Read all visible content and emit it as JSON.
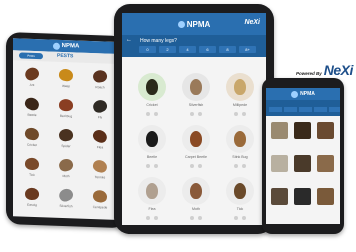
{
  "brand": {
    "app_name": "NPMA",
    "powered_by": "Powered By",
    "nexi": "NeXi"
  },
  "left_tablet": {
    "nav_button": "Pests",
    "section_title": "PESTS",
    "items": [
      {
        "label": "Ant",
        "color": "#6b3a1f"
      },
      {
        "label": "Wasp",
        "color": "#c98a1a"
      },
      {
        "label": "Roach",
        "color": "#5a3320"
      },
      {
        "label": "Beetle",
        "color": "#3a2618"
      },
      {
        "label": "Bed Bug",
        "color": "#8a3e22"
      },
      {
        "label": "Fly",
        "color": "#2f2a24"
      },
      {
        "label": "Cricket",
        "color": "#6f4a2a"
      },
      {
        "label": "Spider",
        "color": "#4a3220"
      },
      {
        "label": "Flea",
        "color": "#5a2e18"
      },
      {
        "label": "Tick",
        "color": "#7a4a2a"
      },
      {
        "label": "Moth",
        "color": "#8a6a4a"
      },
      {
        "label": "Termite",
        "color": "#b08050"
      },
      {
        "label": "Earwig",
        "color": "#6a3a20"
      },
      {
        "label": "Silverfish",
        "color": "#8c8c8c"
      },
      {
        "label": "Centipede",
        "color": "#9a6a3a"
      }
    ]
  },
  "center_tablet": {
    "question": "How many legs?",
    "back_icon": "arrow-left-icon",
    "chips": [
      "0",
      "2",
      "4",
      "6",
      "8",
      "8+"
    ],
    "items": [
      {
        "label": "Cricket",
        "bg": "#d8ead0",
        "bug": "#2a2a1a"
      },
      {
        "label": "Silverfish",
        "bg": "#e6e6e6",
        "bug": "#9a7a5a"
      },
      {
        "label": "Millipede",
        "bg": "#eadfcf",
        "bug": "#c9a76a"
      },
      {
        "label": "Beetle",
        "bg": "#ececec",
        "bug": "#1a1a1a"
      },
      {
        "label": "Carpet Beetle",
        "bg": "#ececec",
        "bug": "#8a4a24"
      },
      {
        "label": "Stink Bug",
        "bg": "#ececec",
        "bug": "#9a6a3a"
      },
      {
        "label": "Flea",
        "bg": "#ececec",
        "bug": "#b0a090"
      },
      {
        "label": "Moth",
        "bg": "#ececec",
        "bug": "#8a5a3a"
      },
      {
        "label": "Tick",
        "bg": "#ececec",
        "bug": "#6a4a2a"
      }
    ]
  },
  "phone": {
    "items": [
      {
        "color": "#9a8a70"
      },
      {
        "color": "#3a2a1a"
      },
      {
        "color": "#6a4a30"
      },
      {
        "color": "#b8b0a0"
      },
      {
        "color": "#4a3a2a"
      },
      {
        "color": "#8a6a4a"
      },
      {
        "color": "#5a4a3a"
      },
      {
        "color": "#2a2a2a"
      },
      {
        "color": "#7a5a3a"
      }
    ]
  }
}
